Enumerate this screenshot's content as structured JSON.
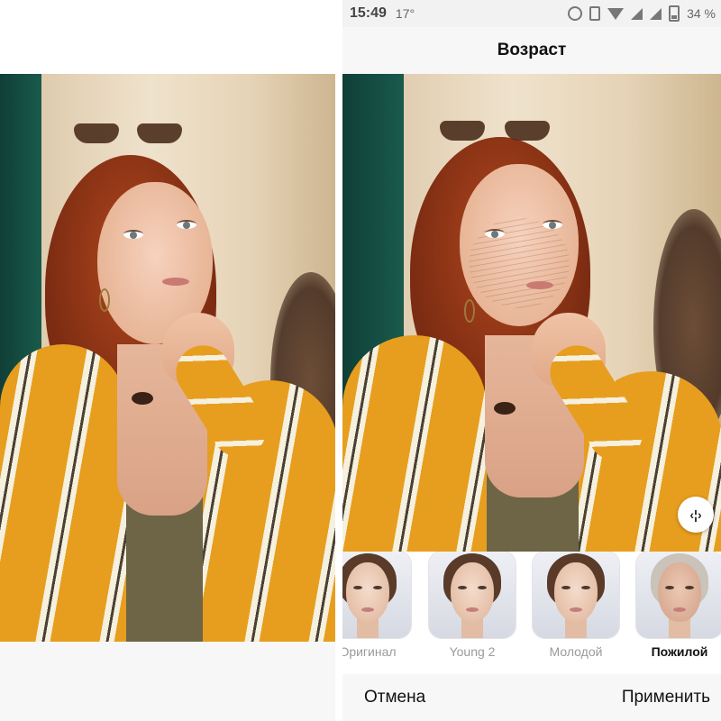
{
  "status_bar": {
    "time": "15:49",
    "temperature": "17°",
    "battery": "34 %",
    "icons": [
      "alarm-icon",
      "vibrate-icon",
      "wifi-icon",
      "signal-icon",
      "signal-icon",
      "battery-icon"
    ]
  },
  "header": {
    "title": "Возраст"
  },
  "compare_handle": {
    "icon": "compare-slider-icon",
    "glyph": "‹¦›"
  },
  "filters": [
    {
      "label": "Оригинал",
      "style": "original",
      "selected": false
    },
    {
      "label": "Young 2",
      "style": "young",
      "selected": false
    },
    {
      "label": "Молодой",
      "style": "young",
      "selected": false
    },
    {
      "label": "Пожилой",
      "style": "elder",
      "selected": true
    }
  ],
  "bottom_bar": {
    "cancel_label": "Отмена",
    "apply_label": "Применить"
  },
  "colors": {
    "accent_text": "#111111",
    "muted_text": "#9a9a9a",
    "jacket": "#e79e1e"
  }
}
